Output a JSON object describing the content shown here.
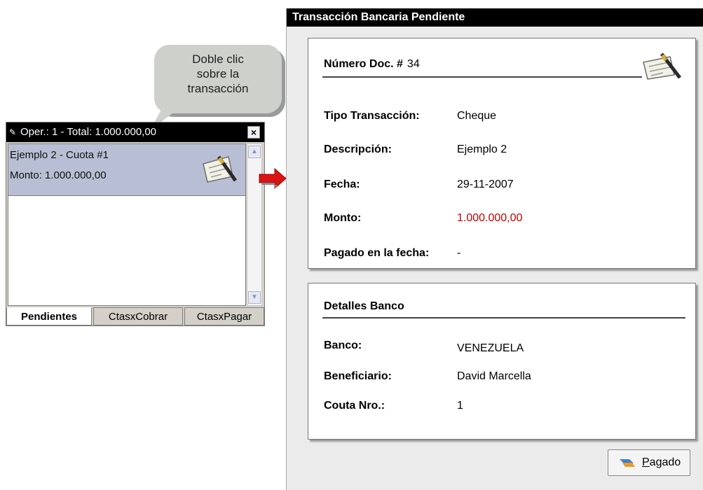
{
  "callout": {
    "lines": [
      "Doble clic",
      "sobre la",
      "transacción"
    ]
  },
  "mini_window": {
    "title": "Oper.: 1 - Total: 1.000.000,00",
    "close_glyph": "×",
    "item": {
      "line1": "Ejemplo 2 - Cuota #1",
      "line2": "Monto: 1.000.000,00"
    },
    "tabs": [
      "Pendientes",
      "CtasxCobrar",
      "CtasxPagar"
    ],
    "active_tab": "Pendientes"
  },
  "dialog": {
    "title": "Transacción Bancaria Pendiente",
    "doc": {
      "header_label": "Número Doc. #",
      "number": "34",
      "rows": [
        {
          "label": "Tipo Transacción:",
          "value": "Cheque"
        },
        {
          "label": "Descripción:",
          "value": "Ejemplo 2"
        },
        {
          "label": "Fecha:",
          "value": "29-11-2007"
        },
        {
          "label": "Monto:",
          "value": "1.000.000,00"
        },
        {
          "label": "Pagado en la fecha:",
          "value": "-"
        }
      ]
    },
    "bank": {
      "header": "Detalles Banco",
      "rows": [
        {
          "label": "Banco:",
          "value": "VENEZUELA"
        },
        {
          "label": "Beneficiario:",
          "value": "David Marcella"
        },
        {
          "label": "Couta Nro.:",
          "value": "1"
        }
      ]
    },
    "paid_button": "Pagado"
  },
  "colors": {
    "amount_red": "#c00000",
    "selected_row": "#b8bfd4",
    "titlebar": "#000000"
  }
}
